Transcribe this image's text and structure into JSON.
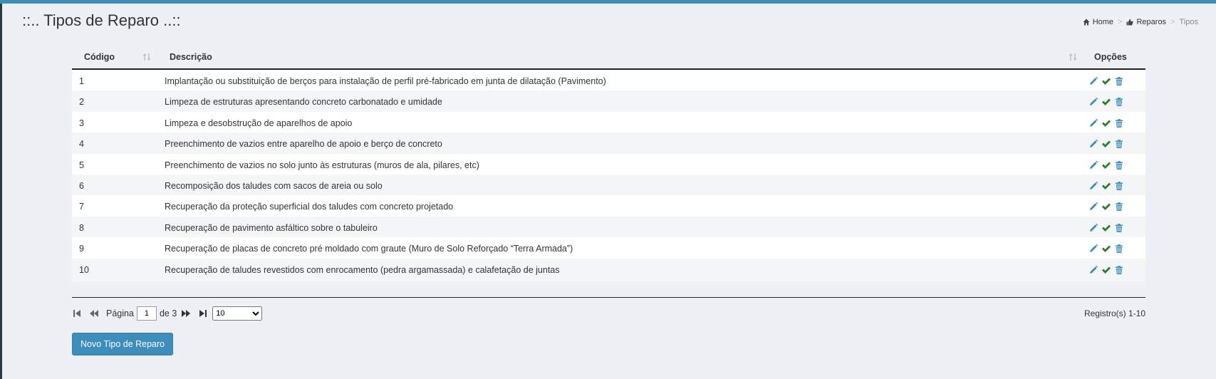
{
  "page": {
    "title": "::.. Tipos de Reparo ..::"
  },
  "breadcrumb": {
    "home": "Home",
    "reparos": "Reparos",
    "current": "Tipos",
    "separator": ">"
  },
  "table": {
    "headers": {
      "code": "Código",
      "description": "Descrição",
      "options": "Opções"
    },
    "rows": [
      {
        "code": "1",
        "description": "Implantação ou substituição de berços para instalação de perfil pré-fabricado em junta de dilatação (Pavimento)"
      },
      {
        "code": "2",
        "description": "Limpeza de estruturas apresentando concreto carbonatado e umidade"
      },
      {
        "code": "3",
        "description": "Limpeza e desobstrução de aparelhos de apoio"
      },
      {
        "code": "4",
        "description": "Preenchimento de vazios entre aparelho de apoio e berço de concreto"
      },
      {
        "code": "5",
        "description": "Preenchimento de vazios no solo junto às estruturas (muros de ala, pilares, etc)"
      },
      {
        "code": "6",
        "description": "Recomposição dos taludes com sacos de areia ou solo"
      },
      {
        "code": "7",
        "description": "Recuperação da proteção superficial dos taludes com concreto projetado"
      },
      {
        "code": "8",
        "description": "Recuperação de pavimento asfáltico sobre o tabuleiro"
      },
      {
        "code": "9",
        "description": "Recuperação de placas de concreto pré moldado com graute (Muro de Solo Reforçado “Terra Armada”)"
      },
      {
        "code": "10",
        "description": "Recuperação de taludes revestidos com enrocamento (pedra argamassada) e calafetação de juntas"
      }
    ]
  },
  "pager": {
    "page_label": "Página",
    "page_value": "1",
    "of_label": "de 3",
    "page_size": "10",
    "page_size_options": [
      "10"
    ],
    "records": "Registro(s) 1-10"
  },
  "actions": {
    "new_label": "Novo Tipo de Reparo"
  },
  "colors": {
    "accent": "#3c8dbc",
    "edit": "#3c8dbc",
    "check": "#2e7d32",
    "trash": "#3c8dbc"
  }
}
